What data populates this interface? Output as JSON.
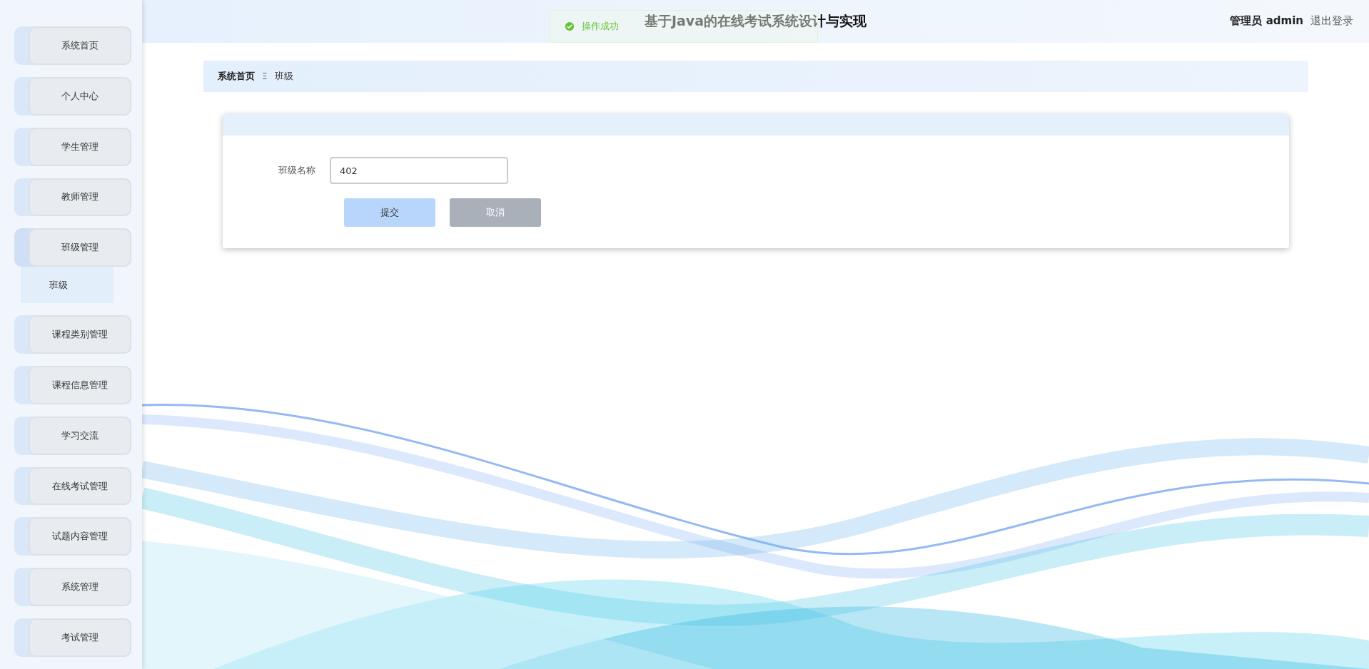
{
  "sidebar": {
    "items": [
      {
        "label": "系统首页",
        "expanded": false
      },
      {
        "label": "个人中心",
        "expanded": false
      },
      {
        "label": "学生管理",
        "expanded": false
      },
      {
        "label": "教师管理",
        "expanded": false
      },
      {
        "label": "班级管理",
        "expanded": true,
        "children": [
          {
            "label": "班级",
            "selected": true
          }
        ]
      },
      {
        "label": "课程类别管理",
        "expanded": false
      },
      {
        "label": "课程信息管理",
        "expanded": false
      },
      {
        "label": "学习交流",
        "expanded": false
      },
      {
        "label": "在线考试管理",
        "expanded": false
      },
      {
        "label": "试题内容管理",
        "expanded": false
      },
      {
        "label": "系统管理",
        "expanded": false
      },
      {
        "label": "考试管理",
        "expanded": false
      }
    ]
  },
  "header": {
    "title": "基于Java的在线考试系统设计与实现",
    "user": "管理员 admin",
    "logout": "退出登录"
  },
  "toast": {
    "message": "操作成功"
  },
  "breadcrumb": {
    "items": [
      "系统首页",
      "班级"
    ],
    "separator": "Ξ"
  },
  "form": {
    "fields": [
      {
        "label": "班级名称",
        "value": "402"
      }
    ],
    "buttons": [
      {
        "label": "提交",
        "kind": "primary"
      },
      {
        "label": "取消",
        "kind": "cancel"
      }
    ]
  }
}
